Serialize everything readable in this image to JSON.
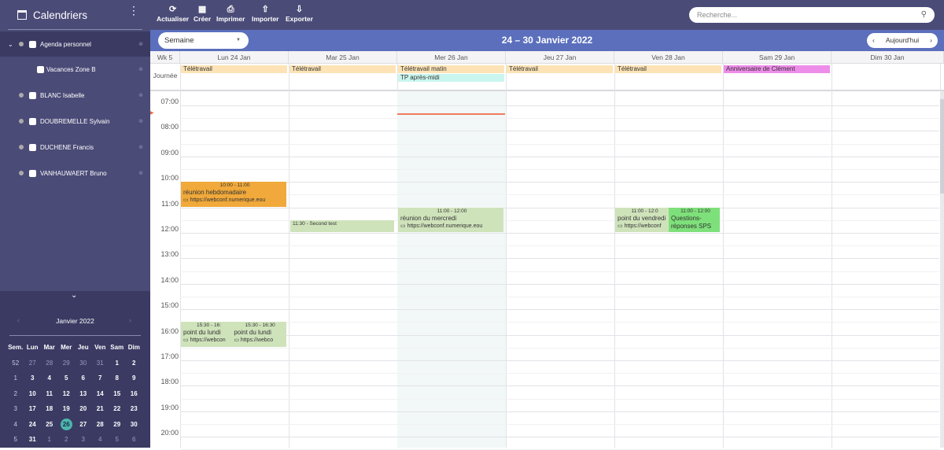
{
  "sidebar": {
    "title": "Calendriers",
    "calendars": [
      {
        "label": "Agenda personnel",
        "sub": false
      },
      {
        "label": "Vacances Zone B",
        "sub": true
      },
      {
        "label": "BLANC Isabelle",
        "sub": false
      },
      {
        "label": "DOUBREMELLE Sylvain",
        "sub": false
      },
      {
        "label": "DUCHENE Francis",
        "sub": false
      },
      {
        "label": "VANHAUWAERT Bruno",
        "sub": false
      }
    ]
  },
  "mini_calendar": {
    "title": "Janvier 2022",
    "headers": [
      "Sem.",
      "Lun",
      "Mar",
      "Mer",
      "Jeu",
      "Ven",
      "Sam",
      "Dim"
    ],
    "weeks": [
      [
        "52",
        "27",
        "28",
        "29",
        "30",
        "31",
        "1",
        "2"
      ],
      [
        "1",
        "3",
        "4",
        "5",
        "6",
        "7",
        "8",
        "9"
      ],
      [
        "2",
        "10",
        "11",
        "12",
        "13",
        "14",
        "15",
        "16"
      ],
      [
        "3",
        "17",
        "18",
        "19",
        "20",
        "21",
        "22",
        "23"
      ],
      [
        "4",
        "24",
        "25",
        "26",
        "27",
        "28",
        "29",
        "30"
      ],
      [
        "5",
        "31",
        "1",
        "2",
        "3",
        "4",
        "5",
        "6"
      ]
    ],
    "today": "26"
  },
  "toolbar": {
    "actualiser": "Actualiser",
    "creer": "Créer",
    "imprimer": "Imprimer",
    "importer": "Importer",
    "exporter": "Exporter",
    "search_placeholder": "Recherche..."
  },
  "nav": {
    "view": "Semaine",
    "range": "24 – 30 Janvier 2022",
    "today": "Aujourd'hui"
  },
  "grid": {
    "week_label": "Wk 5",
    "allday_label": "Journée",
    "days": [
      "Lun 24 Jan",
      "Mar 25 Jan",
      "Mer 26 Jan",
      "Jeu 27 Jan",
      "Ven 28 Jan",
      "Sam 29 Jan",
      "Dim 30 Jan"
    ],
    "hours": [
      "07:00",
      "08:00",
      "09:00",
      "10:00",
      "11:00",
      "12:00",
      "13:00",
      "14:00",
      "15:00",
      "16:00",
      "17:00",
      "18:00",
      "19:00",
      "20:00"
    ]
  },
  "allday_events": [
    {
      "title": "Télétravail",
      "day": 0,
      "row": 0,
      "color": "#fde3b5"
    },
    {
      "title": "Télétravail",
      "day": 1,
      "row": 0,
      "color": "#fde3b5"
    },
    {
      "title": "Télétravail matin",
      "day": 2,
      "row": 0,
      "color": "#fde3b5"
    },
    {
      "title": "TP après-midi",
      "day": 2,
      "row": 1,
      "color": "#c9f6ee"
    },
    {
      "title": "Télétravail",
      "day": 3,
      "row": 0,
      "color": "#fde3b5"
    },
    {
      "title": "Télétravail",
      "day": 4,
      "row": 0,
      "color": "#fde3b5"
    },
    {
      "title": "Anniversaire de Clément",
      "day": 5,
      "row": 0,
      "color": "#ee8de9"
    }
  ],
  "events": [
    {
      "time": "10:00 - 11:00",
      "title": "réunion hebdomadaire",
      "link": "https://webconf.numerique.eou",
      "day": 0,
      "start": 10,
      "end": 11,
      "color": "#f0a93a"
    },
    {
      "time": "11:30 - Second test",
      "title": "",
      "link": "",
      "day": 1,
      "start": 11.5,
      "end": 12,
      "color": "#cfe3bb"
    },
    {
      "time": "11:00 - 12:00",
      "title": "réunion du mercredi",
      "link": "https://webconf.numerique.eou",
      "day": 2,
      "start": 11,
      "end": 12,
      "color": "#cfe3bb"
    },
    {
      "time": "11:00 - 12:0",
      "title": "point du vendredi",
      "link": "https://webconf",
      "day": 4,
      "start": 11,
      "end": 12,
      "color": "#cfe3bb",
      "col": 0
    },
    {
      "time": "11:00 - 12:00",
      "title": "Questions-réponses SPS",
      "link": "",
      "day": 4,
      "start": 11,
      "end": 12,
      "color": "#7ee07a",
      "col": 1
    },
    {
      "time": "15:30 - 16:",
      "title": "point du lundi",
      "link": "https://webcon",
      "day": 0,
      "start": 15.5,
      "end": 16.5,
      "color": "#cfe3bb",
      "col": 0
    },
    {
      "time": "15:30 - 16:30",
      "title": "point du lundi",
      "link": "https://webco",
      "day": 0,
      "start": 15.5,
      "end": 16.5,
      "color": "#cfe3bb",
      "col": 1
    }
  ]
}
